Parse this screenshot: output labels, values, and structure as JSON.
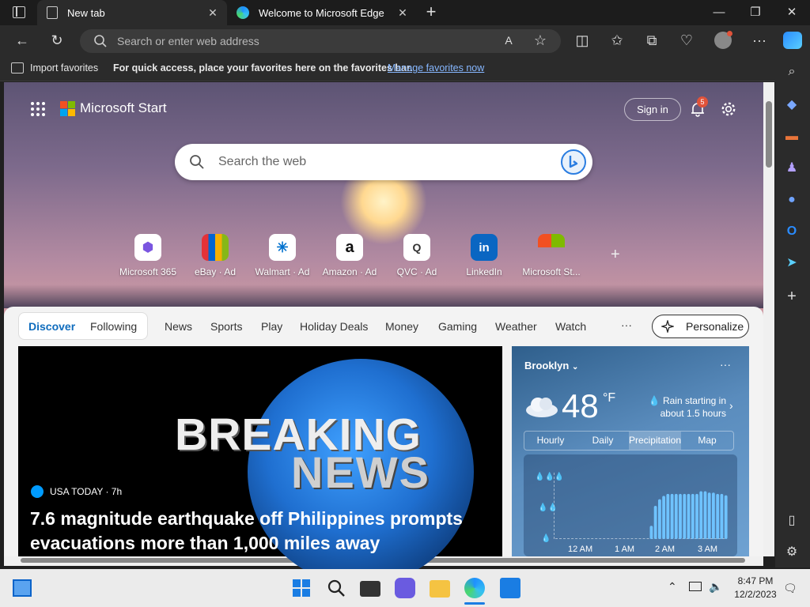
{
  "tabs": [
    {
      "label": "New tab",
      "icon": "document-icon"
    },
    {
      "label": "Welcome to Microsoft Edge",
      "icon": "edge-icon"
    }
  ],
  "address_bar": {
    "placeholder": "Search or enter web address"
  },
  "favorites_bar": {
    "import_label": "Import favorites",
    "message": "For quick access, place your favorites here on the favorites bar.",
    "link": "Manage favorites now"
  },
  "start": {
    "brand": "Microsoft Start",
    "signin": "Sign in",
    "notifications": "5",
    "search_placeholder": "Search the web"
  },
  "quick_links": [
    {
      "label": "Microsoft 365"
    },
    {
      "label": "eBay · Ad"
    },
    {
      "label": "Walmart · Ad"
    },
    {
      "label": "Amazon · Ad"
    },
    {
      "label": "QVC · Ad"
    },
    {
      "label": "LinkedIn"
    },
    {
      "label": "Microsoft St..."
    }
  ],
  "feed_tabs": [
    "Discover",
    "Following",
    "News",
    "Sports",
    "Play",
    "Holiday Deals",
    "Money",
    "Gaming",
    "Weather",
    "Watch"
  ],
  "more_tabs": "···",
  "personalize": "Personalize",
  "hero": {
    "image_text_1": "BREAKING",
    "image_text_2": "NEWS",
    "source": "USA TODAY · 7h",
    "headline": "7.6 magnitude earthquake off Philippines prompts evacuations more than 1,000 miles away"
  },
  "weather": {
    "city": "Brooklyn",
    "temp": "48",
    "unit": "°F",
    "condition_1": "Rain starting in",
    "condition_2": "about 1.5 hours",
    "tabs": [
      "Hourly",
      "Daily",
      "Precipitation",
      "Map"
    ],
    "x_labels": [
      "12 AM",
      "1 AM",
      "2 AM",
      "3 AM"
    ],
    "precip_levels": [
      0,
      0,
      0,
      0,
      0,
      0,
      0,
      0,
      0,
      0,
      0,
      0,
      0,
      0,
      0,
      0,
      0,
      0,
      0,
      0,
      0,
      0,
      0,
      0.2,
      0.5,
      0.6,
      0.65,
      0.68,
      0.68,
      0.68,
      0.68,
      0.68,
      0.68,
      0.68,
      0.68,
      0.72,
      0.72,
      0.7,
      0.7,
      0.68,
      0.68,
      0.66
    ]
  },
  "taskbar": {
    "time": "8:47 PM",
    "date": "12/2/2023"
  }
}
